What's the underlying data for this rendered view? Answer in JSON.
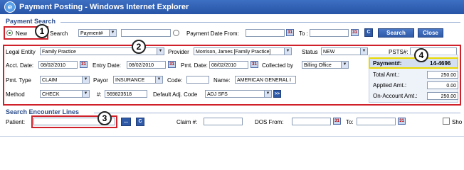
{
  "window": {
    "title": "Payment Posting - Windows Internet Explorer"
  },
  "payment_search": {
    "section_title": "Payment Search",
    "new_label": "New",
    "search_label": "Search",
    "search_type": "Payment#",
    "search_value": "",
    "date_from_label": "Payment Date From:",
    "date_from": "",
    "to_label": "To :",
    "to": "",
    "c_label": "C",
    "search_button": "Search",
    "close_button": "Close"
  },
  "form": {
    "legal_entity_label": "Legal Entity",
    "legal_entity": "Family Practice",
    "provider_label": "Provider",
    "provider": "Morrison, James [Family Practice]",
    "status_label": "Status",
    "status": "NEW",
    "psts_label": "PSTS#:",
    "acct_date_label": "Acct. Date:",
    "acct_date": "08/02/2010",
    "entry_date_label": "Entry Date:",
    "entry_date": "08/02/2010",
    "pmt_date_label": "Pmt. Date:",
    "pmt_date": "08/02/2010",
    "collected_by_label": "Collected by",
    "collected_by": "Billing Office",
    "pmt_type_label": "Pmt. Type",
    "pmt_type": "CLAIM",
    "payor_label": "Payor",
    "payor": "INSURANCE",
    "code_label": "Code:",
    "code": "",
    "name_label": "Name:",
    "name": "AMERICAN GENERAL I",
    "method_label": "Method",
    "method": "CHECK",
    "number_label": "#:",
    "number": "569823518",
    "default_adj_label": "Default Adj. Code",
    "default_adj": "ADJ SFS",
    "go_button": ">>"
  },
  "summary": {
    "payment_num_label": "Payment#:",
    "payment_num": "14-4696",
    "total_label": "Total Amt.:",
    "total": "250.00",
    "applied_label": "Applied Amt.:",
    "applied": "0.00",
    "on_account_label": "On-Account Amt.:",
    "on_account": "250.00"
  },
  "encounter": {
    "section_title": "Search Encounter Lines",
    "patient_label": "Patient:",
    "patient": "",
    "ellipsis_button": "...",
    "c_label": "C",
    "claim_label": "Claim #:",
    "claim": "",
    "dos_from_label": "DOS From:",
    "dos_from": "",
    "to_label": "To:",
    "to": "",
    "show_label": "Sho"
  },
  "callouts": [
    "1",
    "2",
    "3",
    "4"
  ],
  "colors": {
    "titlebar": "#2a5aab",
    "callout_box": "#d0202a",
    "highlight": "#e8d800",
    "accent": "#2f5aa8"
  },
  "icons": [
    "ie-logo-icon",
    "calendar-icon",
    "chevron-down-icon"
  ]
}
